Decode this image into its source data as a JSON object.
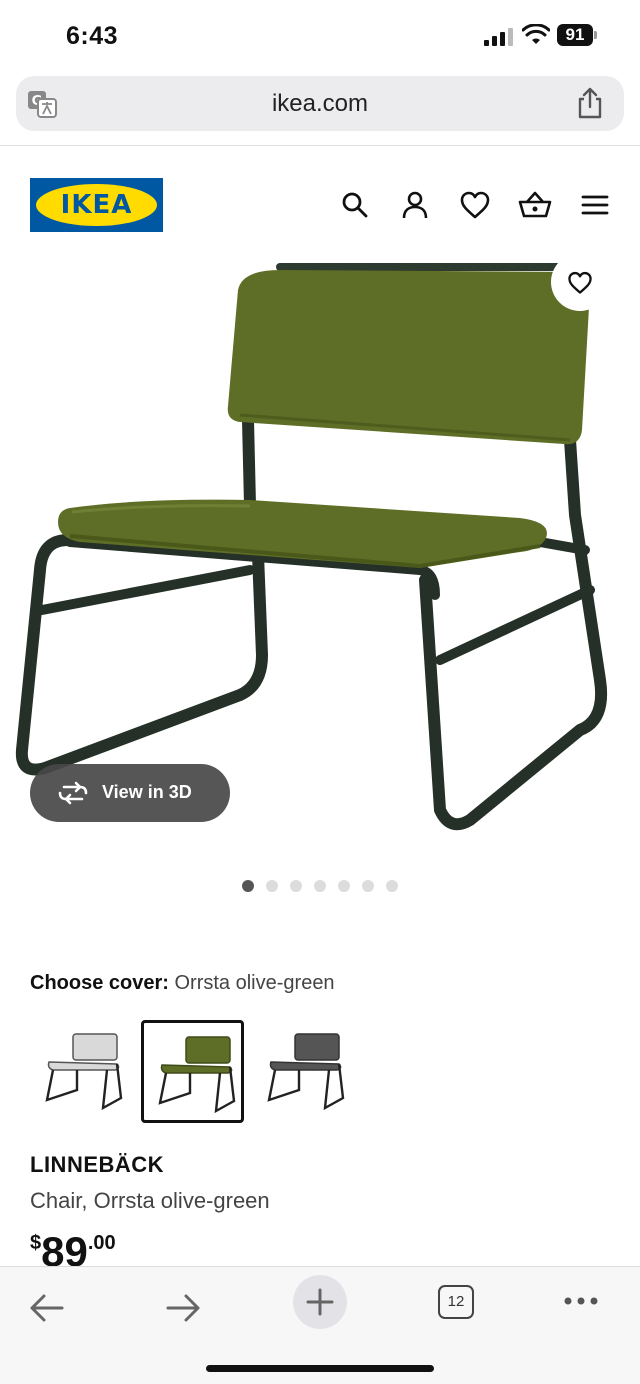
{
  "status_bar": {
    "time": "6:43",
    "battery": "91",
    "icons": [
      "signal-icon",
      "wifi-icon",
      "battery-icon"
    ]
  },
  "browser": {
    "url": "ikea.com",
    "left_icon": "translate-icon",
    "right_icon": "share-icon"
  },
  "header": {
    "logo_text": "IKEA",
    "logo_colors": {
      "blue": "#0058a3",
      "yellow": "#ffdb00"
    },
    "icons": [
      "search-icon",
      "account-icon",
      "favourites-icon",
      "cart-icon",
      "menu-icon"
    ]
  },
  "gallery": {
    "view_3d_label": "View in 3D",
    "favourite_icon": "heart-icon",
    "image_count": 7,
    "active_index": 0,
    "product_color": "#5f6e26"
  },
  "cover": {
    "label": "Choose cover:",
    "selected": "Orrsta olive-green",
    "options": [
      {
        "color": "#d9d9d9"
      },
      {
        "color": "#5f6e26"
      },
      {
        "color": "#555555"
      }
    ],
    "selected_index": 1
  },
  "product": {
    "name": "LINNEBÄCK",
    "description": "Chair, Orrsta olive-green",
    "price_currency": "$",
    "price_main": "89",
    "price_cents": ".00"
  },
  "toolbar": {
    "tabs_count": "12",
    "icons": [
      "back-icon",
      "forward-icon",
      "new-tab-icon",
      "tabs-icon",
      "more-icon"
    ]
  }
}
